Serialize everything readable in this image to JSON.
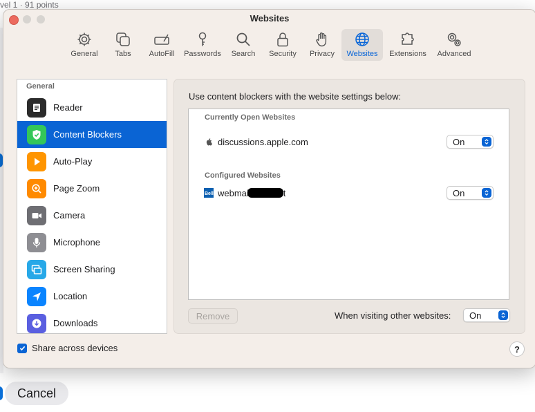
{
  "background": {
    "top_text": "vel 1  ·  91 points",
    "cancel_label": "Cancel"
  },
  "window": {
    "title": "Websites"
  },
  "toolbar": [
    {
      "label": "General",
      "icon": "gear-icon"
    },
    {
      "label": "Tabs",
      "icon": "tabs-icon"
    },
    {
      "label": "AutoFill",
      "icon": "autofill-icon"
    },
    {
      "label": "Passwords",
      "icon": "key-icon"
    },
    {
      "label": "Search",
      "icon": "search-icon"
    },
    {
      "label": "Security",
      "icon": "lock-icon"
    },
    {
      "label": "Privacy",
      "icon": "hand-icon"
    },
    {
      "label": "Websites",
      "icon": "globe-icon",
      "active": true
    },
    {
      "label": "Extensions",
      "icon": "puzzle-icon"
    },
    {
      "label": "Advanced",
      "icon": "gears-icon"
    }
  ],
  "sidebar": {
    "header": "General",
    "items": [
      {
        "label": "Reader",
        "icon": "reader-icon",
        "color": "#2b2b2b"
      },
      {
        "label": "Content Blockers",
        "icon": "shield-check-icon",
        "color": "#34c759",
        "selected": true
      },
      {
        "label": "Auto-Play",
        "icon": "play-icon",
        "color": "#ff9500"
      },
      {
        "label": "Page Zoom",
        "icon": "zoom-icon",
        "color": "#ff8a00"
      },
      {
        "label": "Camera",
        "icon": "camera-icon",
        "color": "#5f6368"
      },
      {
        "label": "Microphone",
        "icon": "microphone-icon",
        "color": "#6e6e73"
      },
      {
        "label": "Screen Sharing",
        "icon": "screen-sharing-icon",
        "color": "#27a8e8"
      },
      {
        "label": "Location",
        "icon": "location-icon",
        "color": "#0a84ff"
      },
      {
        "label": "Downloads",
        "icon": "downloads-icon",
        "color": "#5a5fe0"
      }
    ]
  },
  "panel": {
    "description": "Use content blockers with the website settings below:",
    "open_section": "Currently Open Websites",
    "configured_section": "Configured Websites",
    "open_sites": [
      {
        "name": "discussions.apple.com",
        "value": "On",
        "icon": "apple-icon"
      }
    ],
    "configured_sites": [
      {
        "name_prefix": "webmai",
        "name_suffix": "t",
        "value": "On",
        "icon": "bell-icon"
      }
    ],
    "remove_label": "Remove",
    "other_label": "When visiting other websites:",
    "other_value": "On"
  },
  "footer": {
    "share_label": "Share across devices",
    "share_checked": true,
    "help_label": "?"
  }
}
